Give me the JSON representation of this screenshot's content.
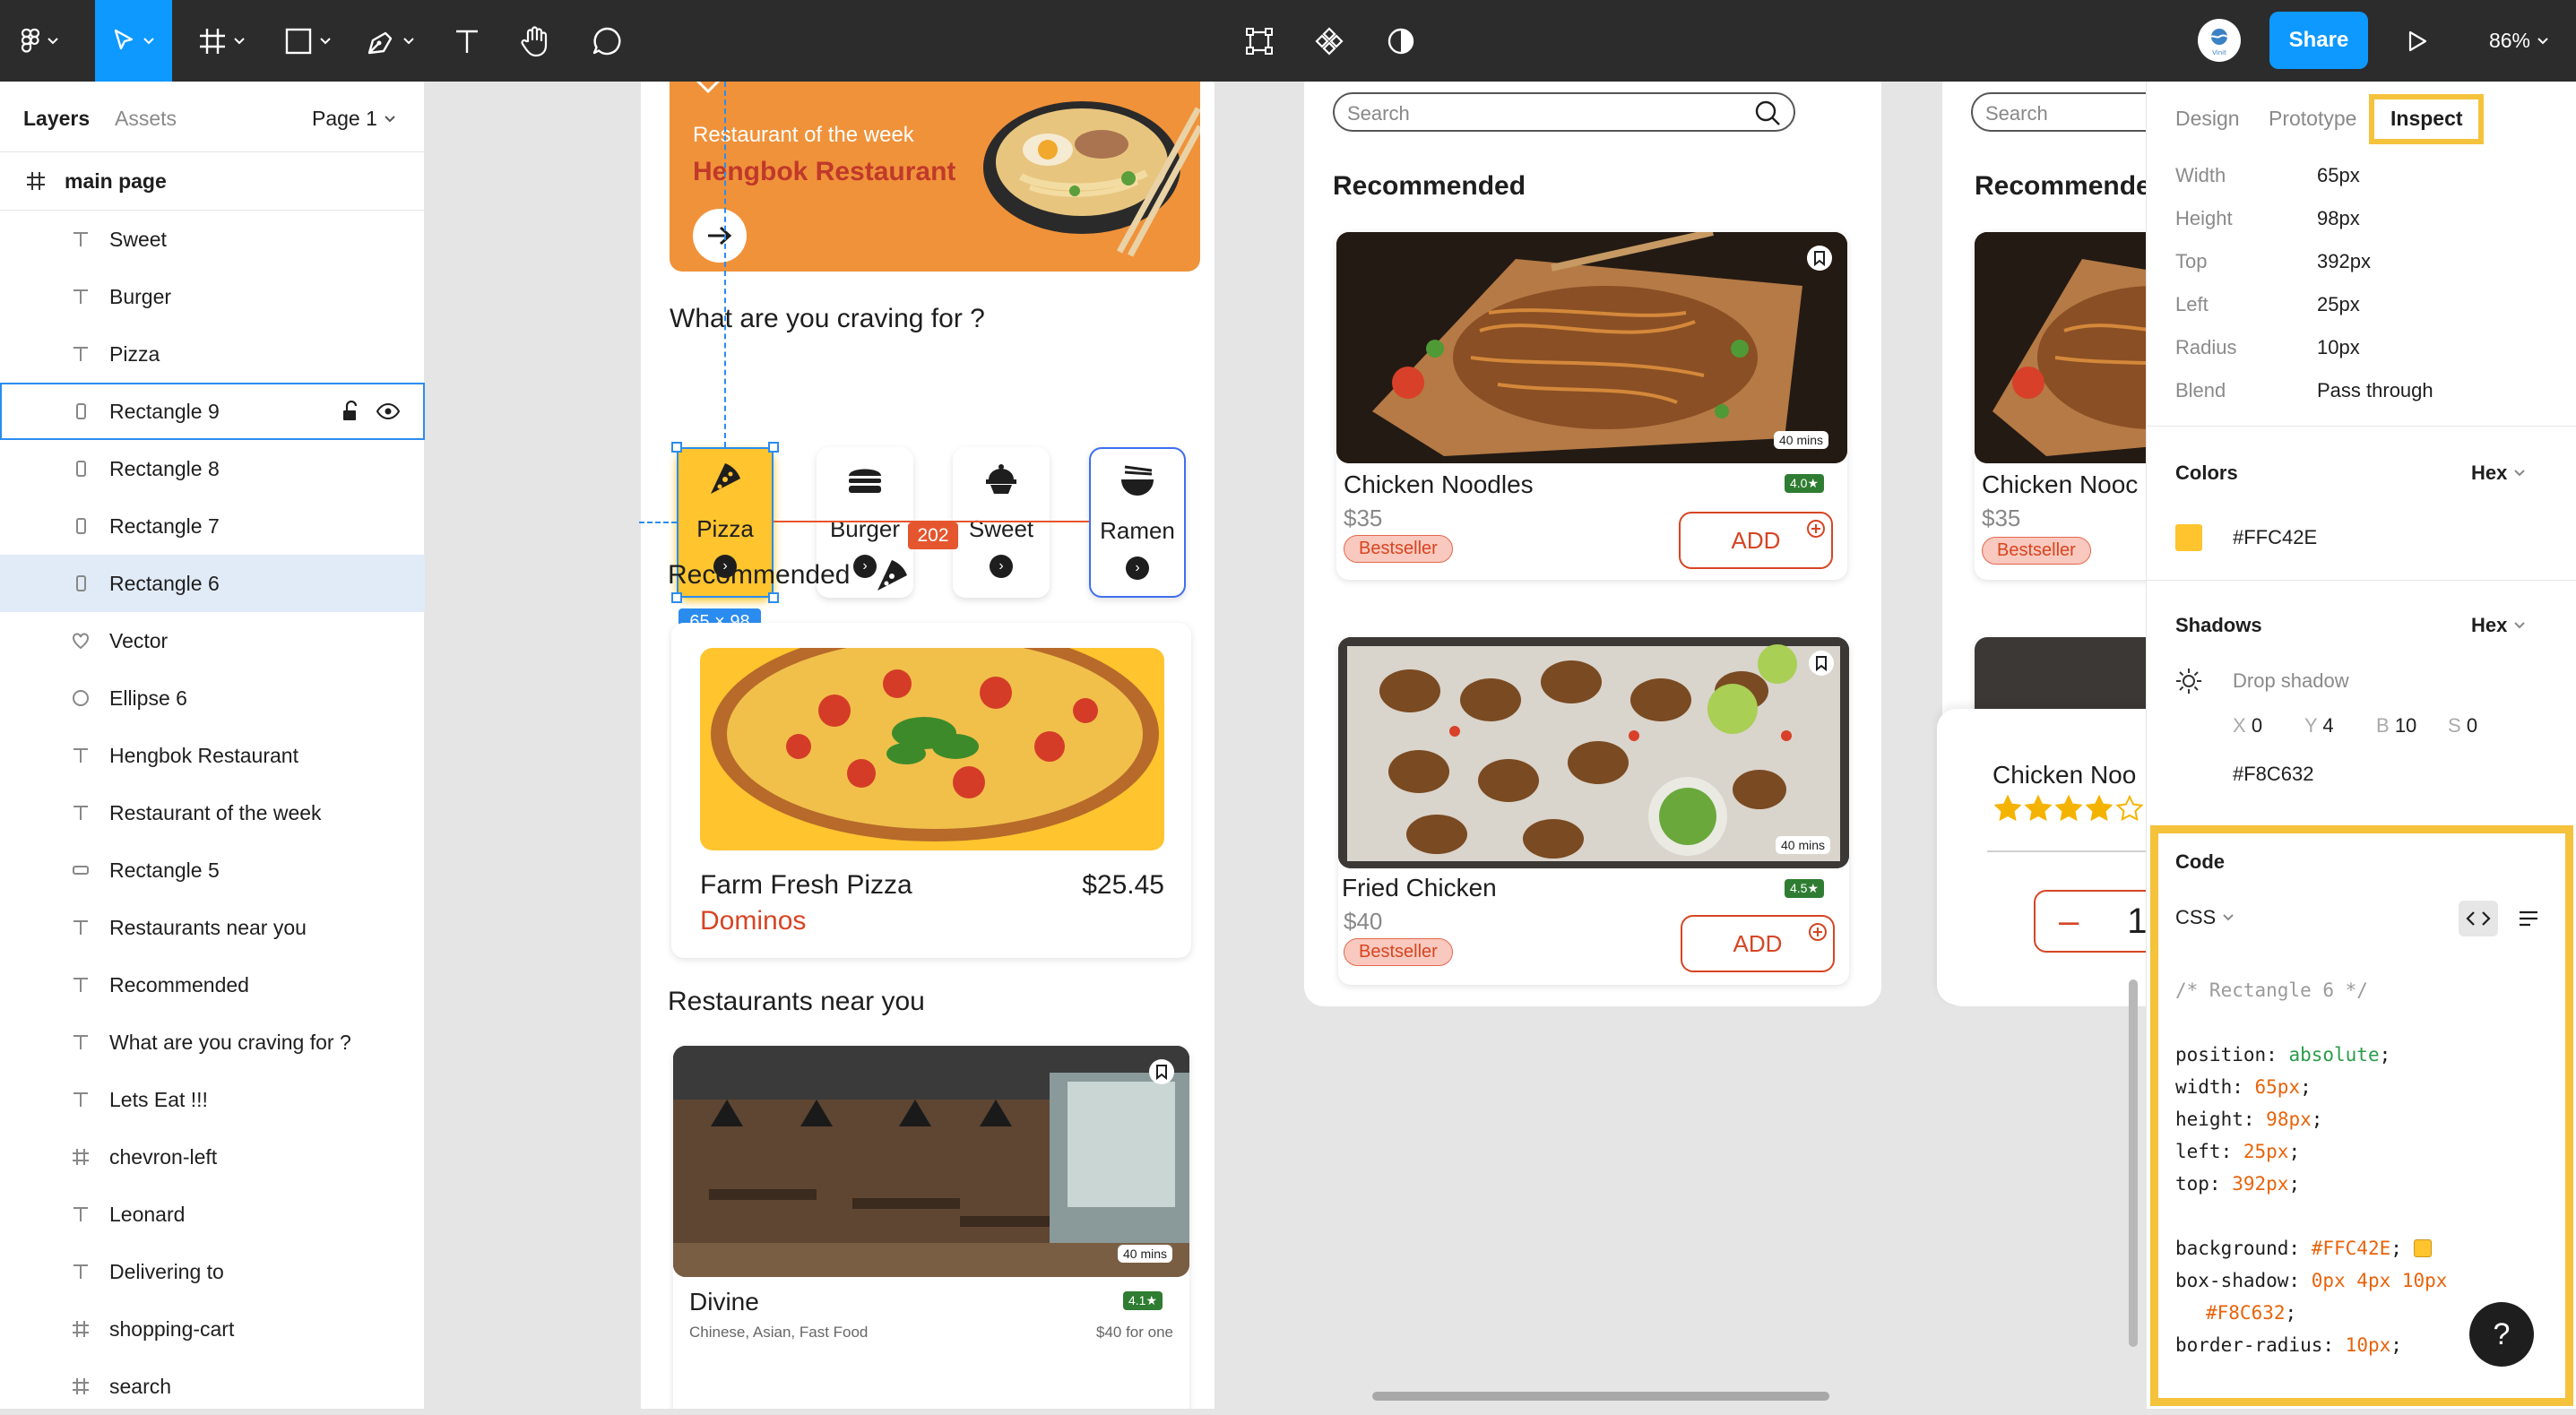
{
  "toolbar": {
    "zoom": "86%",
    "share_label": "Share",
    "avatar_text": "Vinit",
    "tools": [
      "figma-menu-icon",
      "move-tool-icon",
      "frame-tool-icon",
      "shape-tool-icon",
      "pen-tool-icon",
      "text-tool-icon",
      "hand-tool-icon",
      "comment-tool-icon"
    ],
    "center_tools": [
      "component-edit-icon",
      "components-icon",
      "contrast-icon"
    ]
  },
  "left_panel": {
    "tabs": [
      "Layers",
      "Assets"
    ],
    "page_selector": "Page 1",
    "root_frame": "main page",
    "layers": [
      {
        "name": "Sweet",
        "type": "text"
      },
      {
        "name": "Burger",
        "type": "text"
      },
      {
        "name": "Pizza",
        "type": "text"
      },
      {
        "name": "Rectangle 9",
        "type": "rect",
        "hovered": true
      },
      {
        "name": "Rectangle 8",
        "type": "rect"
      },
      {
        "name": "Rectangle 7",
        "type": "rect"
      },
      {
        "name": "Rectangle 6",
        "type": "rect",
        "selected": true
      },
      {
        "name": "Vector",
        "type": "vector"
      },
      {
        "name": "Ellipse 6",
        "type": "ellipse"
      },
      {
        "name": "Hengbok Restaurant",
        "type": "text"
      },
      {
        "name": "Restaurant of the week",
        "type": "text"
      },
      {
        "name": "Rectangle 5",
        "type": "rect-h"
      },
      {
        "name": "Restaurants near you",
        "type": "text"
      },
      {
        "name": "Recommended",
        "type": "text"
      },
      {
        "name": "What are you craving for ?",
        "type": "text"
      },
      {
        "name": "Lets Eat !!!",
        "type": "text"
      },
      {
        "name": "chevron-left",
        "type": "frame"
      },
      {
        "name": "Leonard",
        "type": "text"
      },
      {
        "name": "Delivering to",
        "type": "text"
      },
      {
        "name": "shopping-cart",
        "type": "frame"
      },
      {
        "name": "search",
        "type": "frame"
      }
    ]
  },
  "canvas": {
    "frame1": {
      "banner_subtitle": "Restaurant of the week",
      "banner_title": "Hengbok Restaurant",
      "craving_heading": "What are you craving for ?",
      "categories": [
        "Pizza",
        "Burger",
        "Sweet",
        "Ramen"
      ],
      "selection_size": "65 × 98",
      "spacing_measure": "202",
      "recommended_heading": "Recommended",
      "pizza_name": "Farm Fresh Pizza",
      "pizza_price": "$25.45",
      "pizza_brand": "Dominos",
      "near_heading": "Restaurants near you",
      "restaurant_name": "Divine",
      "restaurant_cuisine": "Chinese, Asian, Fast Food",
      "restaurant_price": "$40 for one",
      "restaurant_rating": "4.1★",
      "restaurant_time": "40 mins"
    },
    "frame2": {
      "search_placeholder": "Search",
      "heading": "Recommended",
      "items": [
        {
          "name": "Chicken Noodles",
          "price": "$35",
          "tag": "Bestseller",
          "rating": "4.0★",
          "time": "40 mins",
          "add": "ADD"
        },
        {
          "name": "Fried Chicken",
          "price": "$40",
          "tag": "Bestseller",
          "rating": "4.5★",
          "time": "40 mins",
          "add": "ADD"
        }
      ]
    },
    "frame3": {
      "search_placeholder": "Search",
      "heading": "Recommende",
      "item_name": "Chicken Nooc",
      "item_price": "$35",
      "item_tag": "Bestseller",
      "popup_name": "Chicken Noo",
      "qty": "1",
      "stars_filled": 4,
      "stars_total": 5
    }
  },
  "right_panel": {
    "tabs": [
      "Design",
      "Prototype",
      "Inspect"
    ],
    "active_tab": "Inspect",
    "properties": [
      {
        "label": "Width",
        "value": "65px"
      },
      {
        "label": "Height",
        "value": "98px"
      },
      {
        "label": "Top",
        "value": "392px"
      },
      {
        "label": "Left",
        "value": "25px"
      },
      {
        "label": "Radius",
        "value": "10px"
      },
      {
        "label": "Blend",
        "value": "Pass through"
      }
    ],
    "colors_heading": "Colors",
    "color_format": "Hex",
    "fill_color": "#FFC42E",
    "shadows_heading": "Shadows",
    "shadow_format": "Hex",
    "shadow_type": "Drop shadow",
    "shadow_x_label": "X",
    "shadow_x": "0",
    "shadow_y_label": "Y",
    "shadow_y": "4",
    "shadow_b_label": "B",
    "shadow_b": "10",
    "shadow_s_label": "S",
    "shadow_s": "0",
    "shadow_color": "#F8C632",
    "code_heading": "Code",
    "code_lang": "CSS",
    "code": {
      "comment": "/* Rectangle 6 */",
      "position_k": "position:",
      "position_v": "absolute",
      "width_k": "width:",
      "width_v": "65px",
      "height_k": "height:",
      "height_v": "98px",
      "left_k": "left:",
      "left_v": "25px",
      "top_k": "top:",
      "top_v": "392px",
      "bg_k": "background:",
      "bg_v": "#FFC42E",
      "shadow_k": "box-shadow:",
      "shadow_v": "0px 4px 10px",
      "shadow_v2": "#F8C632",
      "radius_k": "border-radius:",
      "radius_v": "10px"
    },
    "help_label": "?"
  },
  "colors": {
    "toolbar_bg": "#2c2c2c",
    "accent_blue": "#0d99ff",
    "banner_orange": "#f0923a",
    "category_yellow": "#FFC42E",
    "highlight_yellow": "#f5c23c",
    "brand_red": "#d64524"
  }
}
